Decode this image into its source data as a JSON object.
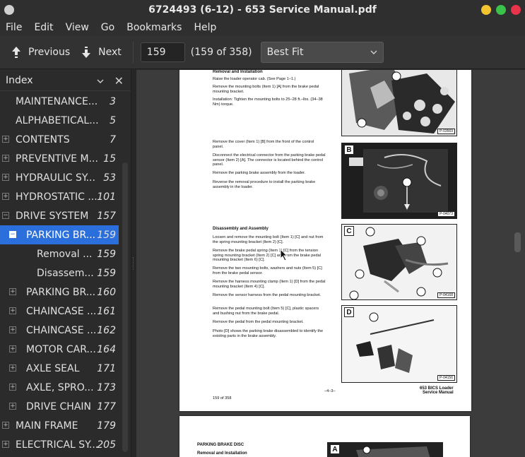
{
  "window": {
    "title": "6724493 (6-12) - 653 Service Manual.pdf"
  },
  "menu": [
    "File",
    "Edit",
    "View",
    "Go",
    "Bookmarks",
    "Help"
  ],
  "toolbar": {
    "previous_label": "Previous",
    "next_label": "Next",
    "page_value": "159",
    "page_of": "(159 of 358)",
    "zoom_value": "Best Fit"
  },
  "sidebar": {
    "title": "Index",
    "items": [
      {
        "label": "MAINTENANCE...",
        "page": "3",
        "level": 0,
        "expander": "none"
      },
      {
        "label": "ALPHABETICAL...",
        "page": "5",
        "level": 0,
        "expander": "none"
      },
      {
        "label": "CONTENTS",
        "page": "7",
        "level": 0,
        "expander": "plus"
      },
      {
        "label": "PREVENTIVE M...",
        "page": "15",
        "level": 0,
        "expander": "plus"
      },
      {
        "label": "HYDRAULIC SY...",
        "page": "53",
        "level": 0,
        "expander": "plus"
      },
      {
        "label": "HYDROSTATIC ...",
        "page": "101",
        "level": 0,
        "expander": "plus"
      },
      {
        "label": "DRIVE SYSTEM",
        "page": "157",
        "level": 0,
        "expander": "minus"
      },
      {
        "label": "PARKING BR...",
        "page": "159",
        "level": 1,
        "expander": "minus",
        "selected": true
      },
      {
        "label": "Removal ...",
        "page": "159",
        "level": 2,
        "expander": "none"
      },
      {
        "label": "Disassem...",
        "page": "159",
        "level": 2,
        "expander": "none"
      },
      {
        "label": "PARKING BR...",
        "page": "160",
        "level": 1,
        "expander": "plus"
      },
      {
        "label": "CHAINCASE ...",
        "page": "161",
        "level": 1,
        "expander": "plus"
      },
      {
        "label": "CHAINCASE ...",
        "page": "162",
        "level": 1,
        "expander": "plus"
      },
      {
        "label": "MOTOR CAR...",
        "page": "164",
        "level": 1,
        "expander": "plus"
      },
      {
        "label": "AXLE SEAL",
        "page": "171",
        "level": 1,
        "expander": "plus"
      },
      {
        "label": "AXLE, SPRO...",
        "page": "173",
        "level": 1,
        "expander": "plus"
      },
      {
        "label": "DRIVE CHAIN",
        "page": "177",
        "level": 1,
        "expander": "plus"
      },
      {
        "label": "MAIN FRAME",
        "page": "179",
        "level": 0,
        "expander": "plus"
      },
      {
        "label": "ELECTRICAL SY...",
        "page": "205",
        "level": 0,
        "expander": "plus"
      }
    ]
  },
  "document": {
    "page1": {
      "heading_top": "Removal and Installation",
      "p1": "Raise the loader operator cab. (See Page 1–1.)",
      "p2": "Remove the mounting bolts (Item 1) [A] from the brake pedal mounting bracket.",
      "p3": "Installation: Tighten the mounting bolts to 25–28 ft.–lbs. (34–38 Nm) torque.",
      "p4": "Remove the cover (Item 1) [B] from the front of the control panel.",
      "p5": "Disconnect the electrical connector from the parking brake pedal sensor (Item 2) [A]. The connector is located behind the control panel.",
      "p6": "Remove the parking brake assembly from the loader.",
      "p7": "Reverse the removal procedure to install the parking brake assembly in the loader.",
      "heading_dis": "Disassembly and Assembly",
      "p8": "Loosen and remove the mounting bolt (Item 1) [C] and nut from the spring mounting bracket (Item 2) [C].",
      "p9": "Remove the brake pedal spring (Item 3) [C] from the tension spring mounting bracket (Item 2) [C] and from the brake pedal mounting bracket (Item 6) [C].",
      "p10": "Remove the two mounting bolts, washers and nuts (Item 5) [C] from the brake pedal sensor.",
      "p11": "Remove the harness mounting clamp (Item 1) [D] from the pedal mounting bracket (Item 4) [C].",
      "p12": "Remove the sensor harness from the pedal mounting bracket.",
      "p13": "Remove the pedal mounting bolt (Item 5) [C], plastic spacers and bushing nut from the brake pedal.",
      "p14": "Remove the pedal from the pedal mounting bracket.",
      "p15": "Photo [D] shows the parking brake disassembled to identify the existing parts in the brake assembly.",
      "page_center": "–4–3–",
      "footer_right_1": "653 BICS Loader",
      "footer_right_2": "Service Manual",
      "footer_left": "159 of 358",
      "photo_a_num": "P-03569",
      "photo_b_tag": "B",
      "photo_b_num": "P-04073",
      "photo_c_tag": "C",
      "photo_c_num": "P-04168",
      "photo_d_tag": "D",
      "photo_d_num": "P-04156"
    },
    "page2": {
      "title": "PARKING BRAKE DISC",
      "subtitle": "Removal and Installation",
      "photo_tag": "A"
    }
  },
  "colors": {
    "selection": "#2a6fdb",
    "min_button": "#f4c430",
    "max_button": "#3ac24a",
    "close_button": "#e8344a"
  }
}
